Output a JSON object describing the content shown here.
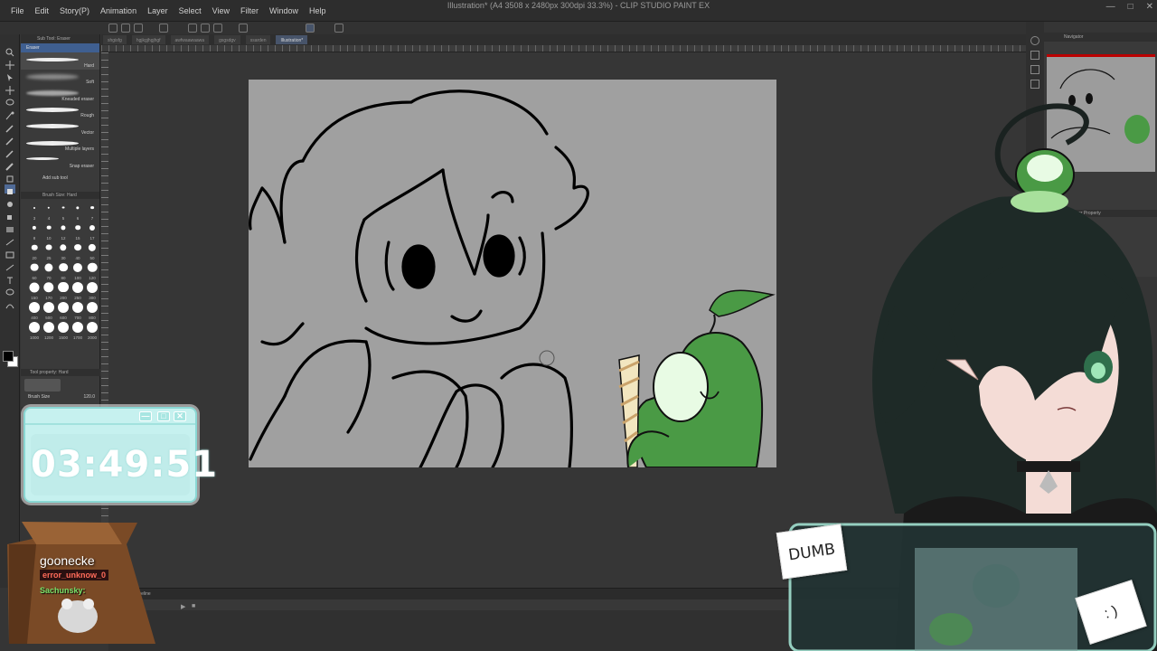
{
  "app": {
    "window_title": "Illustration* (A4 3508 x 2480px 300dpi 33.3%) - CLIP STUDIO PAINT EX",
    "menu": [
      "File",
      "Edit",
      "Story(P)",
      "Animation",
      "Layer",
      "Select",
      "View",
      "Filter",
      "Window",
      "Help"
    ],
    "tabs": [
      "shgisfg",
      "hgjkgjhgjhgf",
      "awfwaawaawa",
      "gsgsdgv",
      "ssarden",
      "Illustration*"
    ]
  },
  "subtool_panel": {
    "title": "Sub Tool: Eraser",
    "group_label": "Eraser",
    "brushes": [
      "Hard",
      "Soft",
      "Kneaded eraser",
      "Rough",
      "Vector",
      "Multiple layers",
      "Snap eraser"
    ],
    "add_sub_tool": "Add sub tool"
  },
  "brush_size_panel": {
    "title": "Brush Size: Hard",
    "sizes": [
      "3",
      "4",
      "5",
      "6",
      "7",
      "8",
      "10",
      "12",
      "15",
      "17",
      "20",
      "25",
      "30",
      "40",
      "50",
      "60",
      "70",
      "80",
      "100",
      "120",
      "150",
      "170",
      "200",
      "250",
      "300",
      "400",
      "500",
      "600",
      "700",
      "800",
      "1000",
      "1200",
      "1500",
      "1700",
      "2000"
    ]
  },
  "tool_property": {
    "title": "Tool property: Hard",
    "brush_size_label": "Brush Size",
    "brush_size_value": "120.0"
  },
  "navigator": {
    "title": "Navigator"
  },
  "layer_property": {
    "title": "Layer Property"
  },
  "timeline": {
    "title": "Timeline",
    "track_label": "Timeline 1"
  },
  "timer": {
    "value": "03:49:51"
  },
  "chat": {
    "username": "goonecke",
    "line1": "error_unknow_0",
    "line2": "Sachunsky:"
  },
  "notes": {
    "sticky_text": "DUMB",
    "smile_text": ": )"
  },
  "colors": {
    "canvas_paper": "#a0a0a0",
    "creature_green": "#4a9a45",
    "timer_cyan": "#c6f1ef",
    "hair_dark": "#1e2a27"
  }
}
